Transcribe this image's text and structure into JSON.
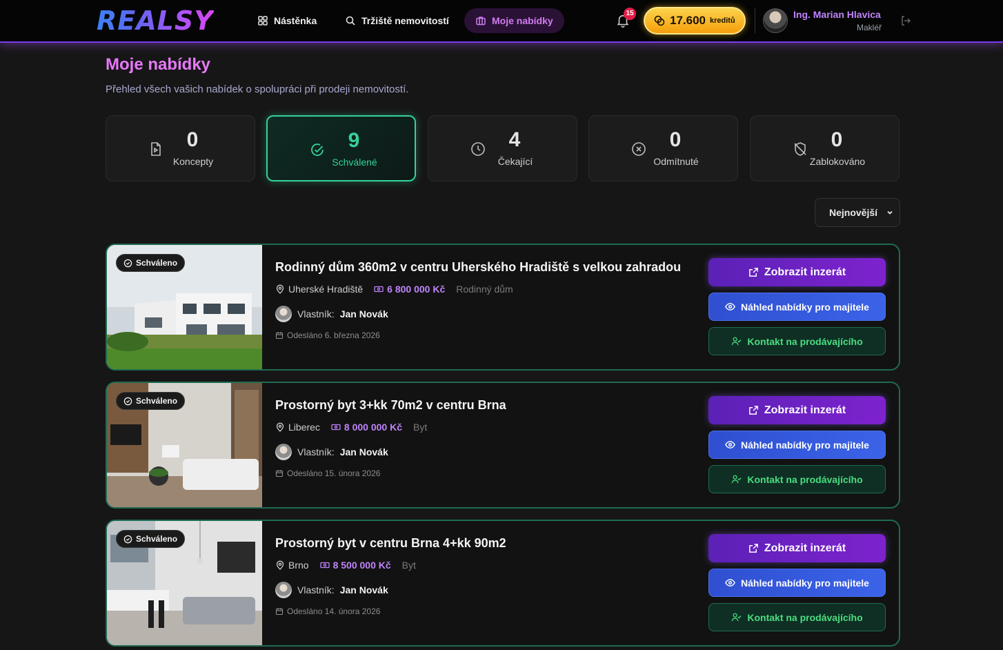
{
  "app": {
    "logo": "REALSY",
    "nav": [
      {
        "label": "Nástěnka",
        "icon": "grid-icon"
      },
      {
        "label": "Tržiště nemovitostí",
        "icon": "search-icon"
      },
      {
        "label": "Moje nabídky",
        "icon": "briefcase-icon",
        "active": true
      }
    ],
    "notifications": {
      "count": "15"
    },
    "credits": {
      "amount": "17.600",
      "unit": "kreditů"
    },
    "user": {
      "name": "Ing. Marian Hlavica",
      "role": "Makléř"
    }
  },
  "page": {
    "title": "Moje nabídky",
    "subtitle": "Přehled všech vašich nabídek o spolupráci při prodeji nemovitostí."
  },
  "stats": [
    {
      "value": "0",
      "label": "Koncepty",
      "icon": "file-play-icon"
    },
    {
      "value": "9",
      "label": "Schválené",
      "icon": "check-circle-icon",
      "active": true
    },
    {
      "value": "4",
      "label": "Čekající",
      "icon": "clock-icon"
    },
    {
      "value": "0",
      "label": "Odmítnuté",
      "icon": "x-circle-icon"
    },
    {
      "value": "0",
      "label": "Zablokováno",
      "icon": "shield-off-icon"
    }
  ],
  "sort": {
    "selected": "Nejnovější"
  },
  "offers": [
    {
      "badge": "Schváleno",
      "title": "Rodinný dům 360m2 v centru Uherského Hradiště s velkou zahradou",
      "location": "Uherské Hradiště",
      "price": "6 800 000 Kč",
      "type": "Rodinný dům",
      "owner_label": "Vlastník:",
      "owner": "Jan Novák",
      "sent": "Odesláno 6. března 2026",
      "btn_view": "Zobrazit inzerát",
      "btn_preview": "Náhled nabídky pro majitele",
      "btn_contact": "Kontakt na prodávajícího"
    },
    {
      "badge": "Schváleno",
      "title": "Prostorný byt 3+kk 70m2 v centru Brna",
      "location": "Liberec",
      "price": "8 000 000 Kč",
      "type": "Byt",
      "owner_label": "Vlastník:",
      "owner": "Jan Novák",
      "sent": "Odesláno 15. února 2026",
      "btn_view": "Zobrazit inzerát",
      "btn_preview": "Náhled nabídky pro majitele",
      "btn_contact": "Kontakt na prodávajícího"
    },
    {
      "badge": "Schváleno",
      "title": "Prostorný byt v centru Brna 4+kk 90m2",
      "location": "Brno",
      "price": "8 500 000 Kč",
      "type": "Byt",
      "owner_label": "Vlastník:",
      "owner": "Jan Novák",
      "sent": "Odesláno 14. února 2026",
      "btn_view": "Zobrazit inzerát",
      "btn_preview": "Náhled nabídky pro majitele",
      "btn_contact": "Kontakt na prodávajícího"
    }
  ]
}
